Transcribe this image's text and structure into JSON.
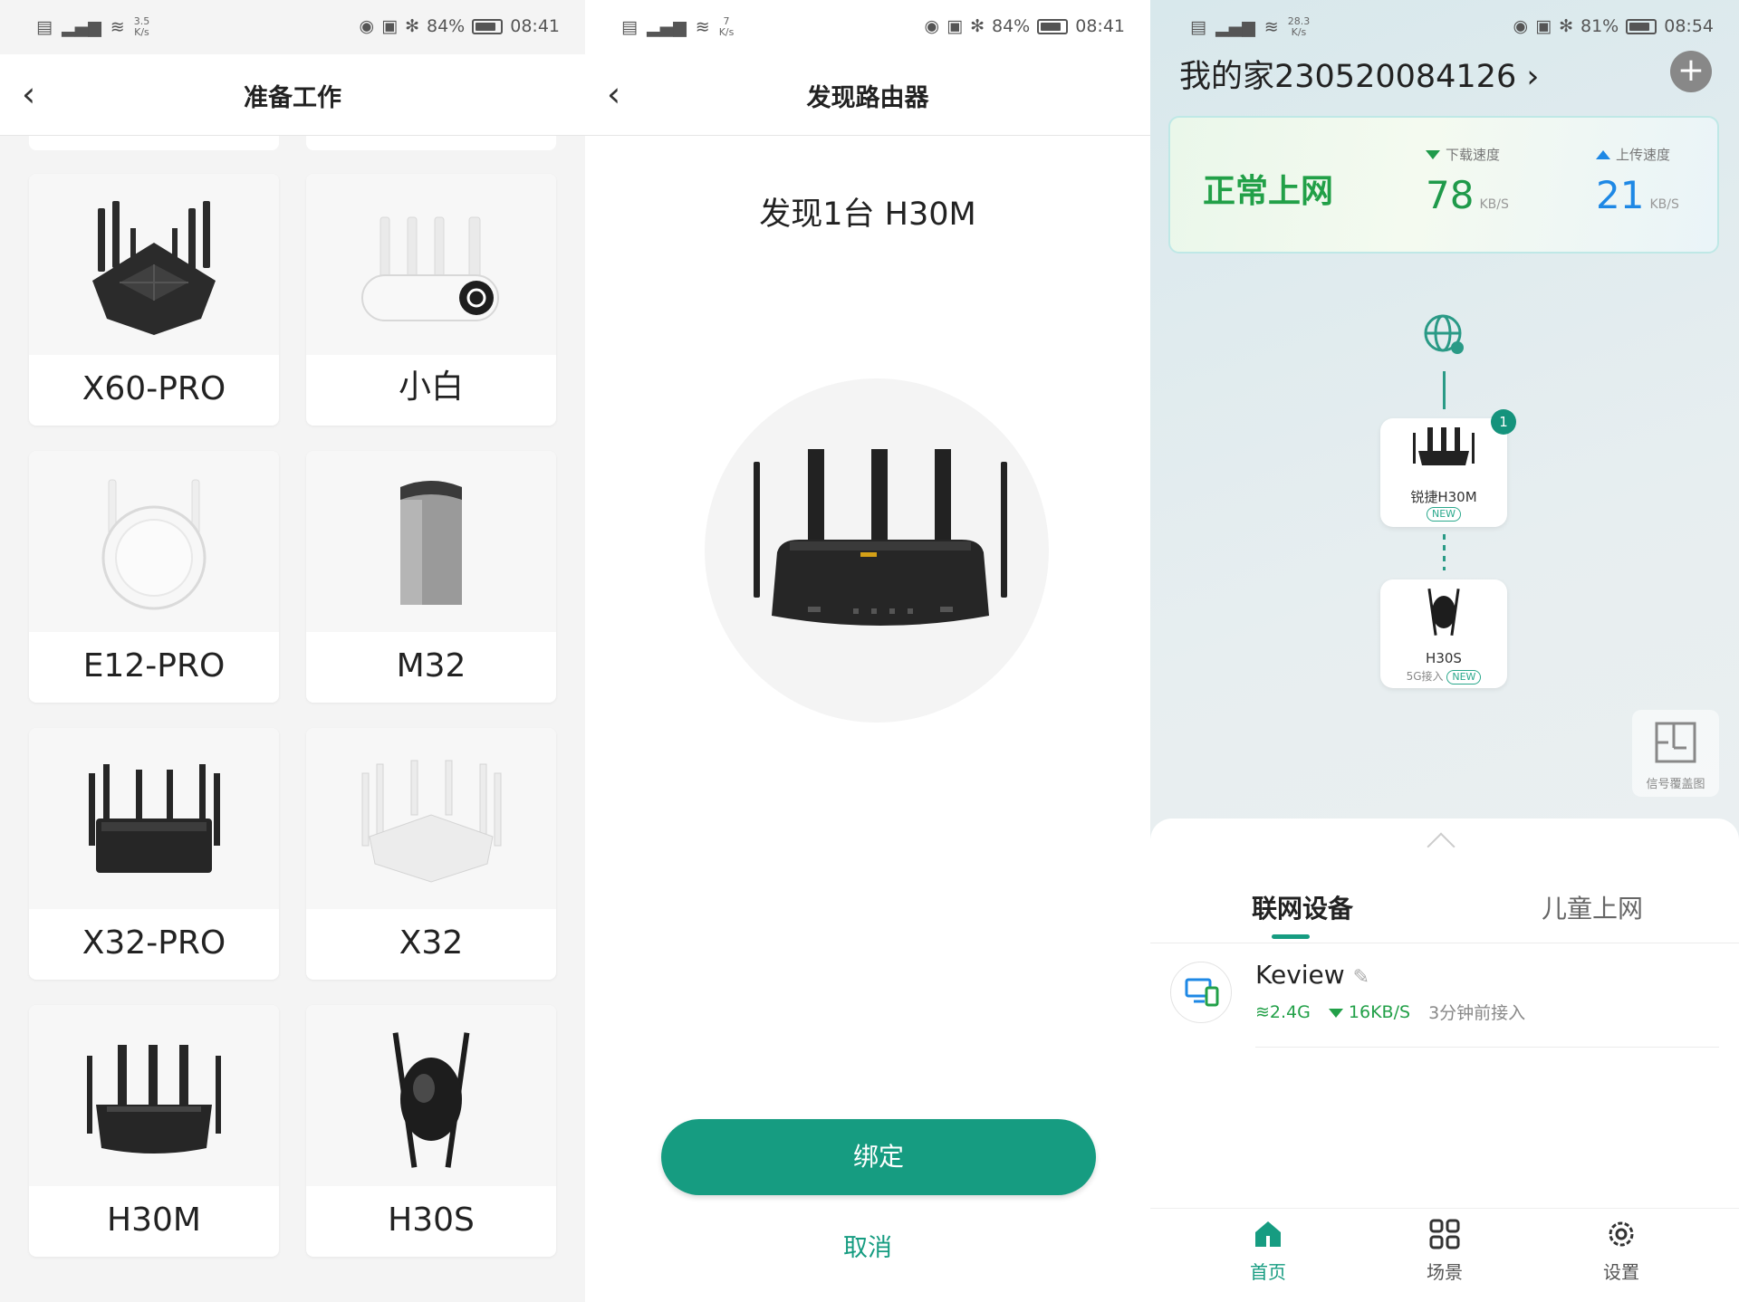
{
  "status_bars": [
    {
      "net": "3.5",
      "net_unit": "K/s",
      "battery": "84%",
      "time": "08:41"
    },
    {
      "net": "7",
      "net_unit": "K/s",
      "battery": "84%",
      "time": "08:41"
    },
    {
      "net": "28.3",
      "net_unit": "K/s",
      "battery": "81%",
      "time": "08:54"
    }
  ],
  "screen1": {
    "back": "‹",
    "title": "准备工作",
    "models": [
      {
        "name": "X60-PRO",
        "icon": "router-x60pro-icon"
      },
      {
        "name": "小白",
        "icon": "router-xiaobai-icon"
      },
      {
        "name": "E12-PRO",
        "icon": "extender-e12pro-icon"
      },
      {
        "name": "M32",
        "icon": "router-m32-icon"
      },
      {
        "name": "X32-PRO",
        "icon": "router-x32pro-icon"
      },
      {
        "name": "X32",
        "icon": "router-x32-icon"
      },
      {
        "name": "H30M",
        "icon": "router-h30m-icon"
      },
      {
        "name": "H30S",
        "icon": "router-h30s-icon"
      }
    ]
  },
  "screen2": {
    "back": "‹",
    "title": "发现路由器",
    "found_text": "发现1台 H30M",
    "bind_button": "绑定",
    "cancel_link": "取消"
  },
  "screen3": {
    "home_title": "我的家230520084126 ›",
    "add_button": "+",
    "net_status": "正常上网",
    "download_caption": "下载速度",
    "download_value": "78",
    "download_unit": "KB/S",
    "upload_caption": "上传速度",
    "upload_value": "21",
    "upload_unit": "KB/S",
    "main_router": {
      "name": "锐捷H30M",
      "tag": "NEW",
      "badge": "1"
    },
    "sub_router": {
      "name": "H30S",
      "sub": "5G接入",
      "tag": "NEW"
    },
    "coverage_label": "信号覆盖图",
    "tabs": {
      "active": "联网设备",
      "inactive": "儿童上网"
    },
    "device": {
      "name": "Keview",
      "band": "2.4G",
      "speed": "16KB/S",
      "joined": "3分钟前接入"
    },
    "bottom_nav": [
      {
        "label": "首页",
        "icon": "home-icon",
        "active": true
      },
      {
        "label": "场景",
        "icon": "scene-grid-icon",
        "active": false
      },
      {
        "label": "设置",
        "icon": "settings-gear-icon",
        "active": false
      }
    ],
    "colors": {
      "accent": "#169c81",
      "ok_green": "#22a048",
      "upload_blue": "#1e88e5"
    }
  }
}
